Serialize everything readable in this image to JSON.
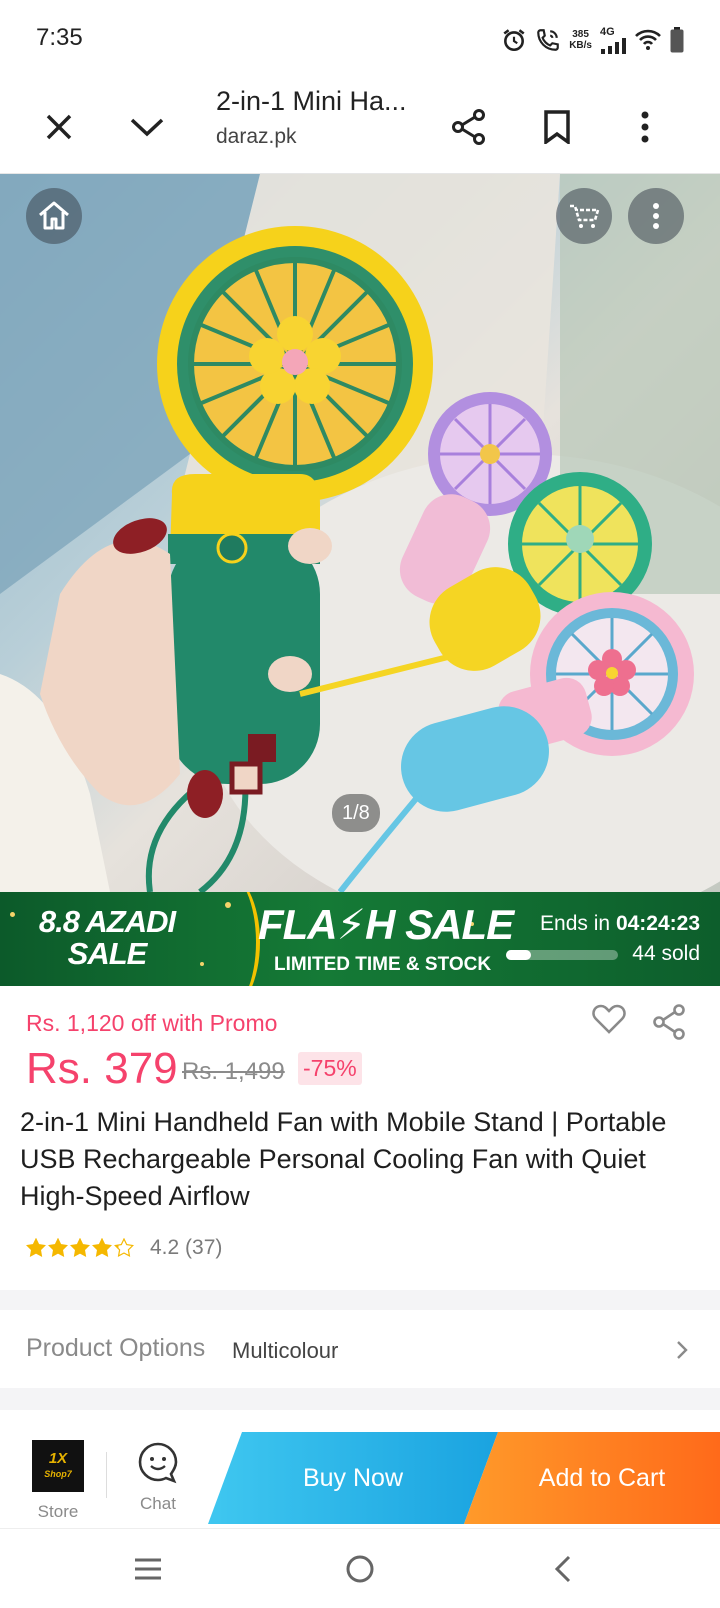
{
  "status_bar": {
    "time": "7:35",
    "speed_value": "385",
    "speed_unit": "KB/s",
    "network": "4G",
    "icons": [
      "alarm-icon",
      "wifi-call-icon",
      "signal-icon",
      "wifi-icon",
      "battery-icon"
    ]
  },
  "browser": {
    "page_title": "2-in-1 Mini Ha...",
    "domain": "daraz.pk",
    "icons": [
      "close-icon",
      "chevron-down-icon",
      "share-icon",
      "bookmark-icon",
      "more-vertical-icon"
    ]
  },
  "gallery": {
    "counter": "1/8",
    "icons": [
      "home-icon",
      "cart-icon",
      "more-vertical-icon"
    ]
  },
  "flash_sale": {
    "event": "8.8 AZADI SALE",
    "event_line1": "8.8 AZADI",
    "event_line2": "SALE",
    "title": "FLA⚡H SALE",
    "subtitle": "LIMITED TIME & STOCK",
    "ends_label": "Ends in",
    "countdown": "04:24:23",
    "sold": "44 sold",
    "sold_progress": 0.22
  },
  "product": {
    "promo": "Rs. 1,120 off with Promo",
    "price": "Rs. 379",
    "original_price": "Rs. 1,499",
    "discount": "-75%",
    "title": "2-in-1 Mini Handheld Fan with Mobile Stand | Portable USB Rechargeable Personal Cooling Fan with Quiet High-Speed Airflow",
    "rating": 4.2,
    "rating_text": "4.2 (37)",
    "icons": [
      "heart-icon",
      "share-icon",
      "star-icon"
    ]
  },
  "options": {
    "label": "Product Options",
    "value": "Multicolour"
  },
  "action_bar": {
    "store_label": "Store",
    "store_logo_text": "1X Shop7",
    "chat_label": "Chat",
    "buy_now": "Buy Now",
    "add_to_cart": "Add to Cart"
  },
  "colors": {
    "price_red": "#f5426c",
    "buy_blue": "#1aa3e0",
    "cart_orange": "#ff6a1a",
    "flash_green": "#157a36",
    "star_gold": "#f5b800"
  }
}
